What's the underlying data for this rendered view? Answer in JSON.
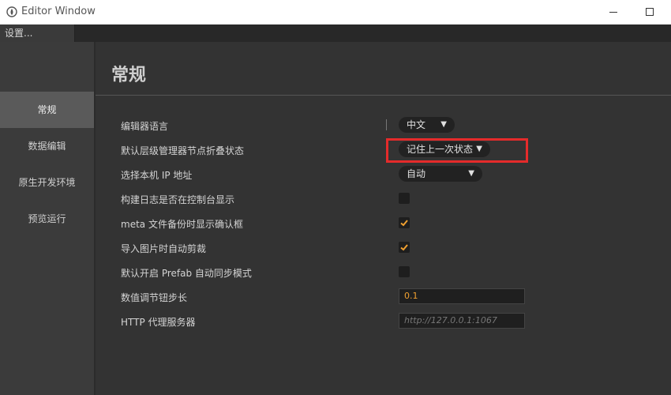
{
  "window": {
    "title": "Editor Window",
    "minimize_icon": "minimize-icon",
    "maximize_icon": "maximize-icon"
  },
  "tabs": [
    {
      "label": "设置..."
    }
  ],
  "sidebar": {
    "items": [
      {
        "label": "常规",
        "active": true
      },
      {
        "label": "数据编辑",
        "active": false
      },
      {
        "label": "原生开发环境",
        "active": false
      },
      {
        "label": "预览运行",
        "active": false
      }
    ]
  },
  "main": {
    "title": "常规",
    "settings": [
      {
        "label": "编辑器语言",
        "control": "select",
        "value": "中文"
      },
      {
        "label": "默认层级管理器节点折叠状态",
        "control": "select",
        "value": "记住上一次状态"
      },
      {
        "label": "选择本机 IP 地址",
        "control": "select",
        "value": "自动"
      },
      {
        "label": "构建日志是否在控制台显示",
        "control": "checkbox",
        "checked": false
      },
      {
        "label": "meta 文件备份时显示确认框",
        "control": "checkbox",
        "checked": true
      },
      {
        "label": "导入图片时自动剪裁",
        "control": "checkbox",
        "checked": true
      },
      {
        "label": "默认开启 Prefab 自动同步模式",
        "control": "checkbox",
        "checked": false
      },
      {
        "label": "数值调节钮步长",
        "control": "input",
        "value": "0.1"
      },
      {
        "label": "HTTP 代理服务器",
        "control": "input",
        "value": "",
        "placeholder": "http://127.0.0.1:1067"
      }
    ]
  },
  "colors": {
    "accent": "#f0a030",
    "highlight": "#e52b2b"
  }
}
